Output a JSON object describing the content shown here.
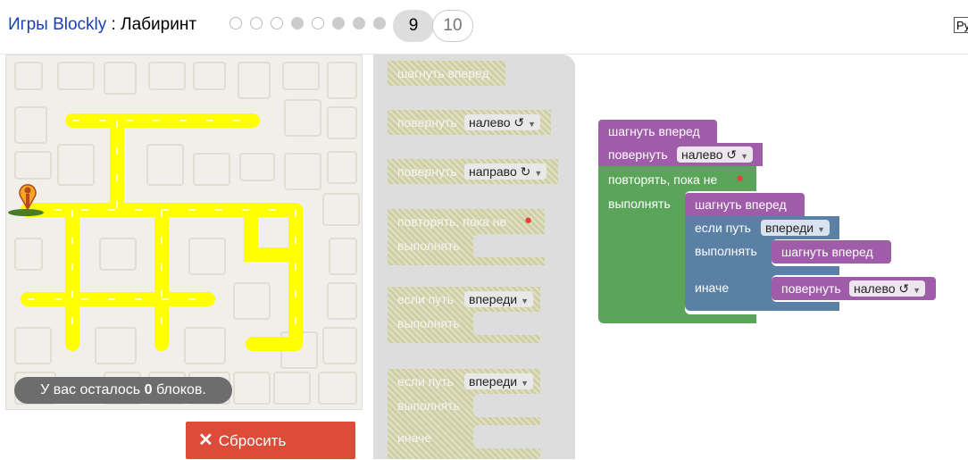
{
  "header": {
    "games_link": "Игры Blockly",
    "separator": " : ",
    "game_name": "Лабиринт",
    "completed_levels": [
      false,
      false,
      false,
      true,
      false,
      true,
      true,
      true
    ],
    "current_level": "9",
    "next_level": "10",
    "language_button": "Ру"
  },
  "maze": {
    "remaining_prefix": "У вас осталось ",
    "remaining_count": "0",
    "remaining_suffix": " блоков.",
    "reset_label": "Сбросить"
  },
  "toolbox": {
    "move_forward": "шагнуть вперед",
    "turn_1": "повернуть",
    "turn_left": "налево ↺",
    "turn_2": "повернуть",
    "turn_right": "направо ↻",
    "repeat_until": "повторять, пока не",
    "repeat_do": "выполнять",
    "if_path": "если путь",
    "if_ahead": "впереди",
    "if_do": "выполнять",
    "ifelse_path": "если путь",
    "ifelse_ahead": "впереди",
    "ifelse_do": "выполнять",
    "ifelse_else": "иначе"
  },
  "workspace": {
    "move_forward_1": "шагнуть вперед",
    "turn": "повернуть",
    "turn_left": "налево ↺",
    "repeat_until": "повторять, пока не",
    "repeat_do": "выполнять",
    "move_forward_2": "шагнуть вперед",
    "if_path": "если путь",
    "if_ahead": "впереди",
    "if_do": "выполнять",
    "move_forward_3": "шагнуть вперед",
    "else": "иначе",
    "turn_2": "повернуть",
    "turn_left_2": "налево ↺"
  },
  "colors": {
    "path": "#ffff00",
    "movement_block": "#9f5ca8",
    "loop_block": "#5ba55b",
    "logic_block": "#5b80a5",
    "reset_button": "#dd4b39"
  }
}
